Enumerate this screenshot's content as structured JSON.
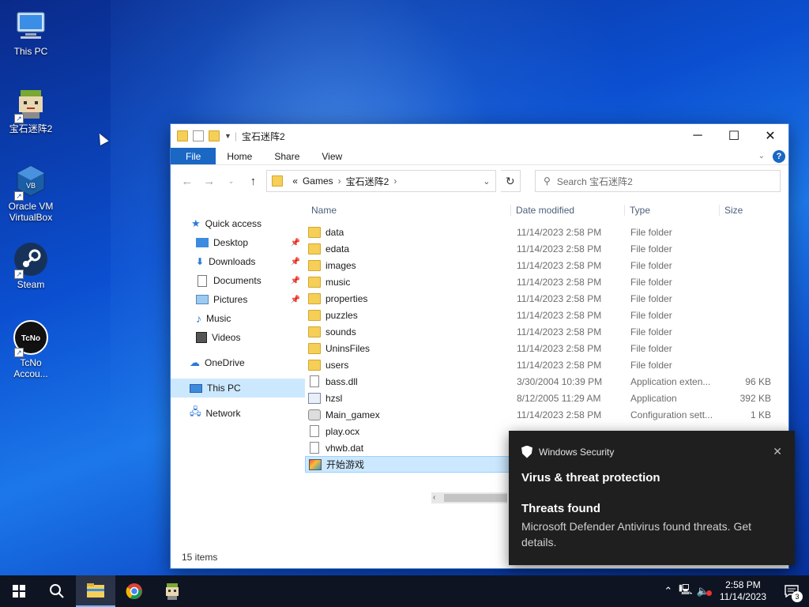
{
  "desktop": {
    "icons": [
      {
        "label": "This PC",
        "icon": "this-pc-icon"
      },
      {
        "label": "宝石迷阵2",
        "icon": "game-icon"
      },
      {
        "label": "Oracle VM VirtualBox",
        "icon": "virtualbox-icon"
      },
      {
        "label": "Steam",
        "icon": "steam-icon"
      },
      {
        "label": "TcNo Accou...",
        "icon": "tcno-icon"
      }
    ]
  },
  "explorer": {
    "title": "宝石迷阵2",
    "ribbon_tabs": [
      "File",
      "Home",
      "Share",
      "View"
    ],
    "address": {
      "prefix": "«",
      "crumbs": [
        "Games",
        "宝石迷阵2"
      ]
    },
    "search_placeholder": "Search 宝石迷阵2",
    "nav": {
      "quick_access": "Quick access",
      "items": [
        "Desktop",
        "Downloads",
        "Documents",
        "Pictures",
        "Music",
        "Videos"
      ],
      "onedrive": "OneDrive",
      "this_pc": "This PC",
      "network": "Network"
    },
    "columns": {
      "name": "Name",
      "date": "Date modified",
      "type": "Type",
      "size": "Size"
    },
    "files": [
      {
        "name": "data",
        "date": "11/14/2023 2:58 PM",
        "type": "File folder",
        "size": "",
        "icon": "folder"
      },
      {
        "name": "edata",
        "date": "11/14/2023 2:58 PM",
        "type": "File folder",
        "size": "",
        "icon": "folder"
      },
      {
        "name": "images",
        "date": "11/14/2023 2:58 PM",
        "type": "File folder",
        "size": "",
        "icon": "folder"
      },
      {
        "name": "music",
        "date": "11/14/2023 2:58 PM",
        "type": "File folder",
        "size": "",
        "icon": "folder"
      },
      {
        "name": "properties",
        "date": "11/14/2023 2:58 PM",
        "type": "File folder",
        "size": "",
        "icon": "folder"
      },
      {
        "name": "puzzles",
        "date": "11/14/2023 2:58 PM",
        "type": "File folder",
        "size": "",
        "icon": "folder"
      },
      {
        "name": "sounds",
        "date": "11/14/2023 2:58 PM",
        "type": "File folder",
        "size": "",
        "icon": "folder"
      },
      {
        "name": "UninsFiles",
        "date": "11/14/2023 2:58 PM",
        "type": "File folder",
        "size": "",
        "icon": "folder"
      },
      {
        "name": "users",
        "date": "11/14/2023 2:58 PM",
        "type": "File folder",
        "size": "",
        "icon": "folder"
      },
      {
        "name": "bass.dll",
        "date": "3/30/2004 10:39 PM",
        "type": "Application exten...",
        "size": "96 KB",
        "icon": "file"
      },
      {
        "name": "hzsl",
        "date": "8/12/2005 11:29 AM",
        "type": "Application",
        "size": "392 KB",
        "icon": "app"
      },
      {
        "name": "Main_gamex",
        "date": "11/14/2023 2:58 PM",
        "type": "Configuration sett...",
        "size": "1 KB",
        "icon": "gear"
      },
      {
        "name": "play.ocx",
        "date": "",
        "type": "",
        "size": "",
        "icon": "file"
      },
      {
        "name": "vhwb.dat",
        "date": "",
        "type": "",
        "size": "",
        "icon": "file"
      },
      {
        "name": "开始游戏",
        "date": "",
        "type": "",
        "size": "",
        "icon": "game"
      }
    ],
    "status": "15 items"
  },
  "toast": {
    "app": "Windows Security",
    "title": "Virus & threat protection",
    "heading": "Threats found",
    "message": "Microsoft Defender Antivirus found threats. Get details."
  },
  "taskbar": {
    "time": "2:58 PM",
    "date": "11/14/2023",
    "notifications": "3"
  }
}
